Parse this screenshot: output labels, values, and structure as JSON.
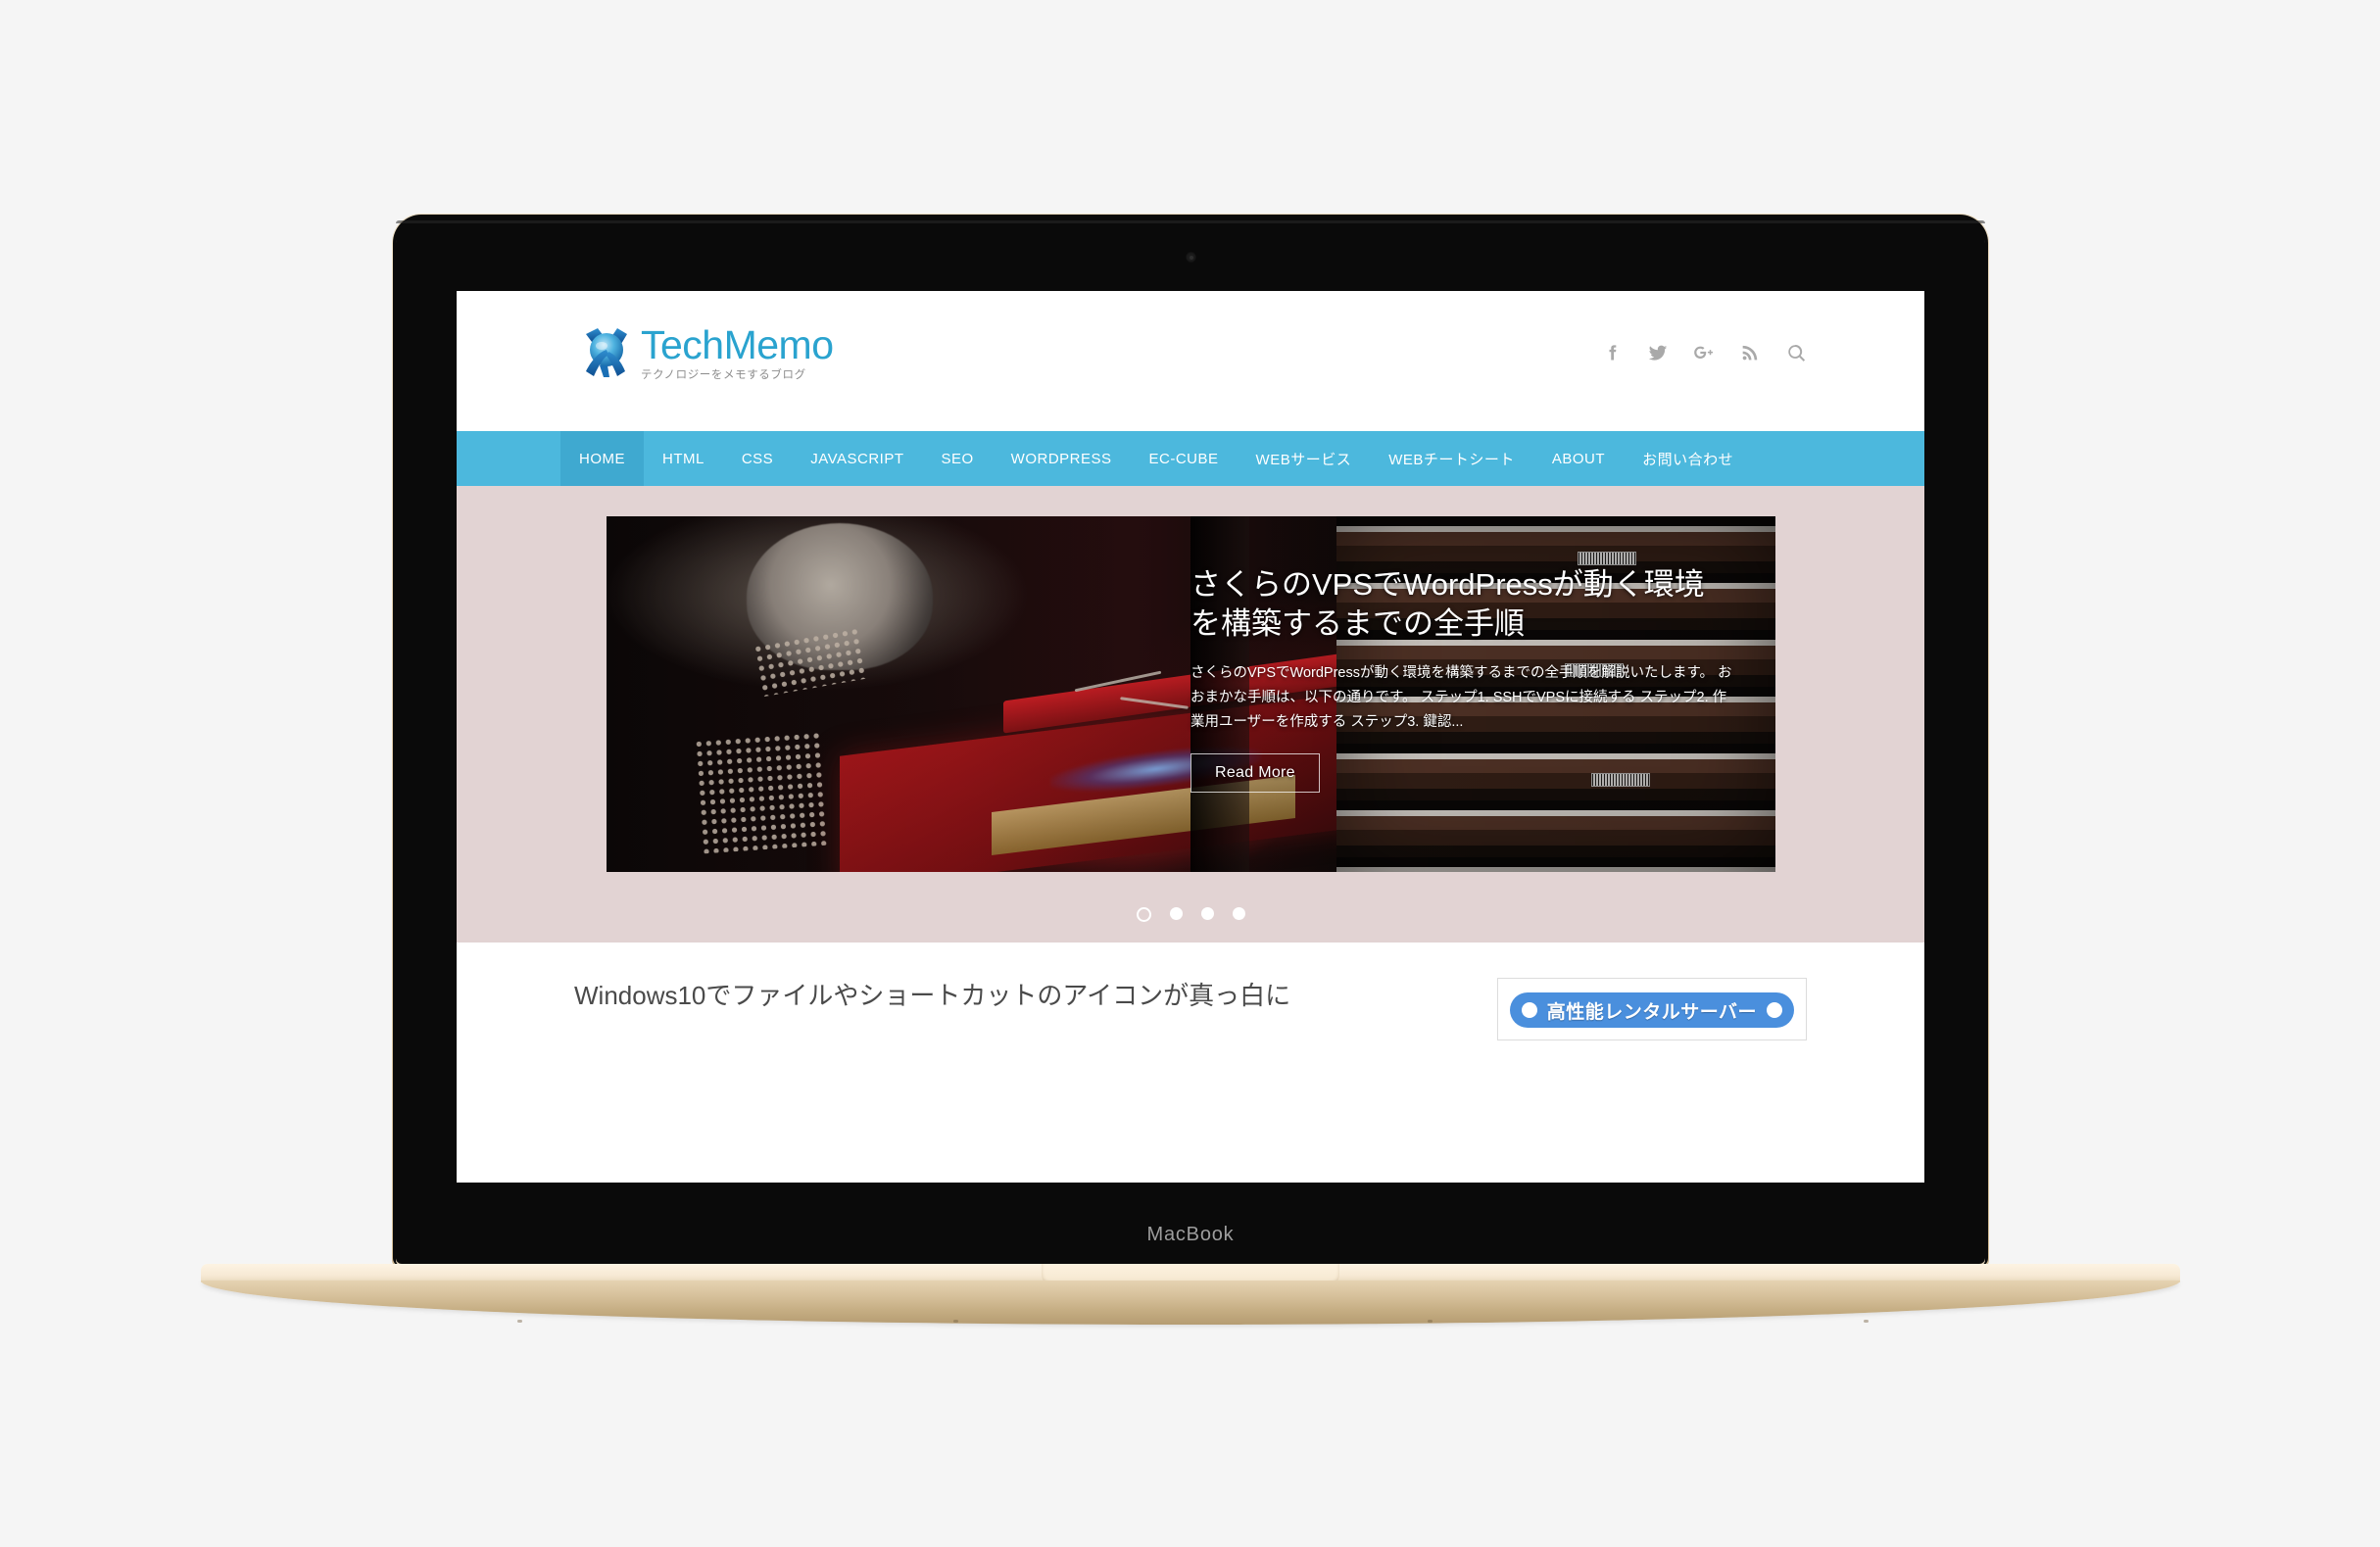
{
  "device": {
    "label": "MacBook",
    "finish_color": "#e6d3b2"
  },
  "site": {
    "logo": {
      "title_part1": "Tech",
      "title_part2": "Memo",
      "title_full": "TechMemo",
      "tagline": "テクノロジーをメモするブログ",
      "brand_color": "#2aa3cf"
    },
    "social_icons": [
      {
        "name": "facebook-icon",
        "label": "Facebook"
      },
      {
        "name": "twitter-icon",
        "label": "Twitter"
      },
      {
        "name": "google-plus-icon",
        "label": "Google Plus"
      },
      {
        "name": "rss-icon",
        "label": "RSS"
      },
      {
        "name": "search-icon",
        "label": "Search"
      }
    ],
    "nav": {
      "background_color": "#4cb8dd",
      "active_background_color": "#3fa9d0",
      "items": [
        {
          "label": "HOME",
          "active": true
        },
        {
          "label": "HTML",
          "active": false
        },
        {
          "label": "CSS",
          "active": false
        },
        {
          "label": "JAVASCRIPT",
          "active": false
        },
        {
          "label": "SEO",
          "active": false
        },
        {
          "label": "WORDPRESS",
          "active": false
        },
        {
          "label": "EC-CUBE",
          "active": false
        },
        {
          "label": "WEBサービス",
          "active": false
        },
        {
          "label": "WEBチートシート",
          "active": false
        },
        {
          "label": "ABOUT",
          "active": false
        },
        {
          "label": "お問い合わせ",
          "active": false
        }
      ]
    },
    "carousel": {
      "background_color": "#e2d3d3",
      "slide": {
        "title": "さくらのVPSでWordPressが動く環境を構築するまでの全手順",
        "excerpt": "さくらのVPSでWordPressが動く環境を構築するまでの全手順を解説いたします。 おおまかな手順は、以下の通りです。 ステップ1. SSHでVPSに接続する ステップ2. 作業用ユーザーを作成する ステップ3. 鍵認...",
        "read_more_label": "Read More",
        "image_alt": "PC内部とサーバーラックの写真"
      },
      "dots": [
        {
          "active": true
        },
        {
          "active": false
        },
        {
          "active": false
        },
        {
          "active": false
        }
      ]
    },
    "content": {
      "post_title": "Windows10でファイルやショートカットのアイコンが真っ白に",
      "ad": {
        "label": "高性能レンタルサーバー",
        "background_color": "#4a8fdd"
      }
    }
  }
}
